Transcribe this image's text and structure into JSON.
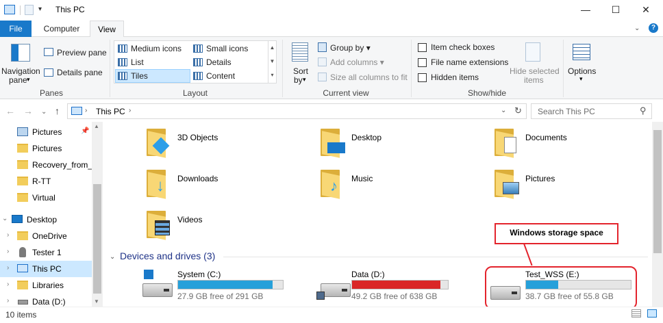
{
  "window": {
    "title": "This PC"
  },
  "tabs": [
    "File",
    "Computer",
    "View"
  ],
  "ribbon": {
    "panes": {
      "group": "Panes",
      "navigation_pane": "Navigation",
      "navigation_pane2": "pane",
      "preview_pane": "Preview pane",
      "details_pane": "Details pane"
    },
    "layout": {
      "group": "Layout",
      "items": [
        "Medium icons",
        "Small icons",
        "List",
        "Details",
        "Tiles",
        "Content"
      ]
    },
    "current_view": {
      "group": "Current view",
      "sort_by": "Sort",
      "sort_by2": "by",
      "group_by": "Group by",
      "add_columns": "Add columns",
      "size_all": "Size all columns to fit"
    },
    "show_hide": {
      "group": "Show/hide",
      "item_check_boxes": "Item check boxes",
      "file_name_extensions": "File name extensions",
      "hidden_items": "Hidden items",
      "hide_selected": "Hide selected",
      "hide_selected2": "items"
    },
    "options": "Options"
  },
  "address": {
    "path": "This PC",
    "search_placeholder": "Search This PC"
  },
  "nav": [
    {
      "label": "Pictures",
      "pinned": true
    },
    {
      "label": "Pictures"
    },
    {
      "label": "Recovery_from_l"
    },
    {
      "label": "R-TT"
    },
    {
      "label": "Virtual"
    },
    {
      "label": "Desktop"
    },
    {
      "label": "OneDrive"
    },
    {
      "label": "Tester 1"
    },
    {
      "label": "This PC"
    },
    {
      "label": "Libraries"
    },
    {
      "label": "Data (D:)"
    }
  ],
  "folders": [
    "3D Objects",
    "Desktop",
    "Documents",
    "Downloads",
    "Music",
    "Pictures",
    "Videos"
  ],
  "devices_header": "Devices and drives (3)",
  "drives": [
    {
      "name": "System (C:)",
      "free": "27.9 GB free of 291 GB",
      "used_fraction": 0.904,
      "color": "#26a0da"
    },
    {
      "name": "Data (D:)",
      "free": "49.2 GB free of 638 GB",
      "used_fraction": 0.923,
      "color": "#da2626"
    },
    {
      "name": "Test_WSS (E:)",
      "free": "38.7 GB free of 55.8 GB",
      "used_fraction": 0.306,
      "color": "#26a0da"
    }
  ],
  "callout": "Windows storage space",
  "status": {
    "items": "10 items"
  }
}
